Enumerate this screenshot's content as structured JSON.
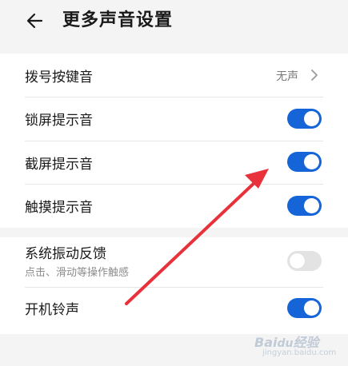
{
  "header": {
    "title": "更多声音设置"
  },
  "settings_group_1": [
    {
      "label": "拨号按键音",
      "value": "无声"
    },
    {
      "label": "锁屏提示音",
      "enabled": true
    },
    {
      "label": "截屏提示音",
      "enabled": true
    },
    {
      "label": "触摸提示音",
      "enabled": true
    }
  ],
  "settings_group_2": [
    {
      "label": "系统振动反馈",
      "description": "点击、滑动等操作触感",
      "enabled": false
    },
    {
      "label": "开机铃声",
      "enabled": true
    }
  ],
  "colors": {
    "toggle_on": "#1565d8",
    "toggle_off": "#e3e3e3",
    "annotation_arrow": "#e8313a"
  },
  "watermark": {
    "logo": "Baidu经验",
    "url": "jingyan.baidu.com"
  }
}
